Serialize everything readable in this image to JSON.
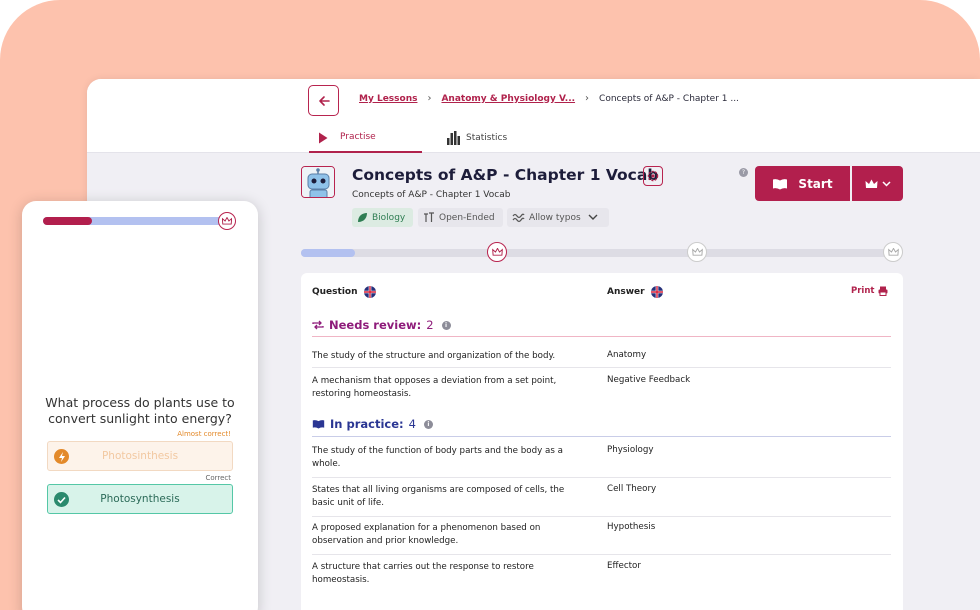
{
  "colors": {
    "background_blob": "#fdc2ad",
    "brand": "#b21f4d",
    "progress": "#b3c1f0",
    "needs_review": "#8e1b7a",
    "in_practice": "#2a3693",
    "correct": "#54c7a6",
    "almost": "#e38a2b"
  },
  "header": {
    "breadcrumb": [
      {
        "label": "My Lessons",
        "link": true
      },
      {
        "label": "Anatomy & Physiology V...",
        "link": true
      },
      {
        "label": "Concepts of A&P - Chapter 1 ...",
        "link": false
      }
    ],
    "tabs": [
      {
        "label": "Practise",
        "icon": "play-icon",
        "active": true
      },
      {
        "label": "Statistics",
        "icon": "bar-chart-icon",
        "active": false
      }
    ]
  },
  "lesson": {
    "title": "Concepts of A&P - Chapter 1 Vocab",
    "subtitle": "Concepts of A&P - Chapter 1 Vocab",
    "tags": [
      {
        "label": "Biology",
        "icon": "leaf-icon"
      },
      {
        "label": "Open-Ended",
        "icon": "text-size-icon"
      },
      {
        "label": "Allow typos",
        "icon": "squiggle-icon"
      }
    ],
    "start_label": "Start",
    "help": "?"
  },
  "progress": {
    "fraction": 0.09
  },
  "table": {
    "question_header": "Question",
    "answer_header": "Answer",
    "print_label": "Print",
    "sections": [
      {
        "title": "Needs review:",
        "count": "2",
        "rows": [
          {
            "q": "The study of the structure and organization of the body.",
            "a": "Anatomy"
          },
          {
            "q": "A mechanism that opposes a deviation from a set point, restoring homeostasis.",
            "a": "Negative Feedback"
          }
        ]
      },
      {
        "title": "In practice:",
        "count": "4",
        "rows": [
          {
            "q": "The study of the function of body parts and the body as a whole.",
            "a": "Physiology"
          },
          {
            "q": "States that all living organisms are composed of cells, the basic unit of life.",
            "a": "Cell Theory"
          },
          {
            "q": "A proposed explanation for a phenomenon based on observation and prior knowledge.",
            "a": "Hypothesis"
          },
          {
            "q": "A structure that carries out the response to restore homeostasis.",
            "a": "Effector"
          }
        ]
      }
    ]
  },
  "phone": {
    "progress_fraction": 0.27,
    "question": "What process do plants use to convert sunlight into energy?",
    "almost_label": "Almost correct!",
    "almost_answer": "Photosinthesis",
    "correct_label": "Correct",
    "correct_answer": "Photosynthesis"
  }
}
